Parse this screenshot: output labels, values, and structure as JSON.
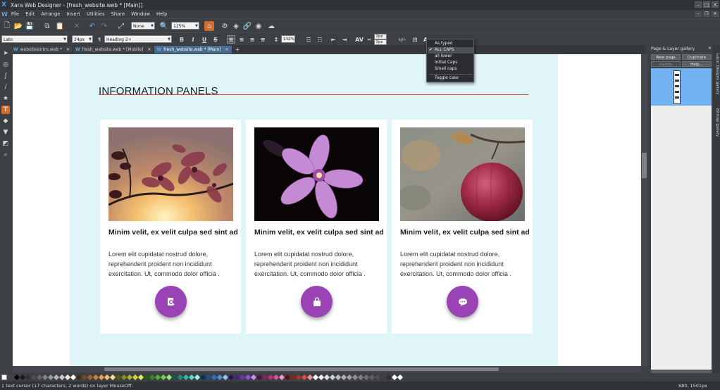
{
  "window": {
    "title": "Xara Web Designer - [fresh_website.web * [Main]]",
    "app_icon": "xara-logo-icon"
  },
  "menubar": {
    "items": [
      "File",
      "Edit",
      "Arrange",
      "Insert",
      "Utilities",
      "Share",
      "Window",
      "Help"
    ]
  },
  "toolbar": {
    "quality_value": "None",
    "zoom_value": "125%"
  },
  "text_toolbar": {
    "font_value": "Lato",
    "size_value": "24px",
    "style_value": "Heading 2+",
    "bold": "B",
    "italic": "I",
    "underline": "U",
    "strike": "S",
    "line_spacing_value": "132%",
    "letter_spacing_value": "0px",
    "baseline_value": "0px",
    "syllable_label": "syl-",
    "case_button": "A"
  },
  "tabs": [
    {
      "label": "websitesintro.web *",
      "active": false
    },
    {
      "label": "fresh_website.web * [Mobile]",
      "active": false
    },
    {
      "label": "fresh_website.web * [Main]",
      "active": true
    }
  ],
  "case_menu": {
    "items": [
      {
        "label": "As typed",
        "checked": false
      },
      {
        "label": "ALL CAPS",
        "checked": true
      },
      {
        "label": "all lower",
        "checked": false
      },
      {
        "label": "Initial Caps",
        "checked": false
      },
      {
        "label": "Small caps",
        "checked": false
      },
      {
        "label": "Toggle case",
        "checked": false
      }
    ],
    "check_mark": "✔"
  },
  "page": {
    "heading": "INFORMATION PANELS",
    "band_color": "#e0f5f8",
    "accent_line_color": "#d64535",
    "cards": [
      {
        "title": "Minim velit, ex velit culpa sed sint ad",
        "body": "Lorem elit cupidatat nostrud dolore, reprehenderit proident non incididunt exercitation. Ut, commodo dolor officia .",
        "image": "silhouette-flowers-sunset",
        "button_icon": "search-document-icon"
      },
      {
        "title": "Minim velit, ex velit culpa sed sint ad",
        "body": "Lorem elit cupidatat nostrud dolore, reprehenderit proident non incididunt exercitation. Ut, commodo dolor officia .",
        "image": "pink-flower-black-background",
        "button_icon": "shopping-bag-icon"
      },
      {
        "title": "Minim velit, ex velit culpa sed sint ad",
        "body": "Lorem elit cupidatat nostrud dolore, reprehenderit proident non incididunt exercitation. Ut, commodo dolor officia .",
        "image": "red-apple-on-branch",
        "button_icon": "chat-bubble-icon"
      }
    ],
    "button_color": "#9a43b5"
  },
  "right_panel": {
    "title": "Page & Layer gallery",
    "new_page": "New page",
    "duplicate": "Duplicate",
    "delete": "Delete",
    "help": "Help...",
    "side_tabs": [
      "Local Designs gallery",
      "Bitmap gallery"
    ]
  },
  "status": {
    "text": "1 text cursor (17 characters, 2 words) on layer MouseOff:",
    "coords": "680, 1501px"
  },
  "palette_colors": [
    "#000000",
    "#1a1a1a",
    "#333333",
    "#4d4d4d",
    "#666666",
    "#808080",
    "#999999",
    "#b3b3b3",
    "#cccccc",
    "#e6e6e6",
    "#ffffff",
    "#4a2a14",
    "#7a4a1c",
    "#a0622a",
    "#c8813a",
    "#e8a050",
    "#f5c070",
    "#fadc90",
    "#5a5a10",
    "#8a8a20",
    "#b0b030",
    "#d0d040",
    "#e8e860",
    "#2a5a10",
    "#3a8a20",
    "#50b030",
    "#70d050",
    "#a0e880",
    "#105a4a",
    "#20907a",
    "#30b8a0",
    "#60d8c0",
    "#a0f0e0",
    "#10305a",
    "#20508a",
    "#3070b8",
    "#5090d8",
    "#90c0f0",
    "#2a105a",
    "#4a208a",
    "#7030b8",
    "#9050d8",
    "#c090f0",
    "#5a1040",
    "#8a2060",
    "#b83080",
    "#d850a0",
    "#f090c8",
    "#5a1010",
    "#8a2020",
    "#b83030",
    "#d85050",
    "#f09090",
    "#ffffff",
    "#f0f0f0",
    "#e0e0e0",
    "#d0d0d0",
    "#c0c0c0",
    "#b0b0b0",
    "#a0a0a0",
    "#909090",
    "#808080",
    "#707070",
    "#606060",
    "#505050",
    "#404040",
    "#303030",
    "#ffffff",
    "#ffffff"
  ]
}
